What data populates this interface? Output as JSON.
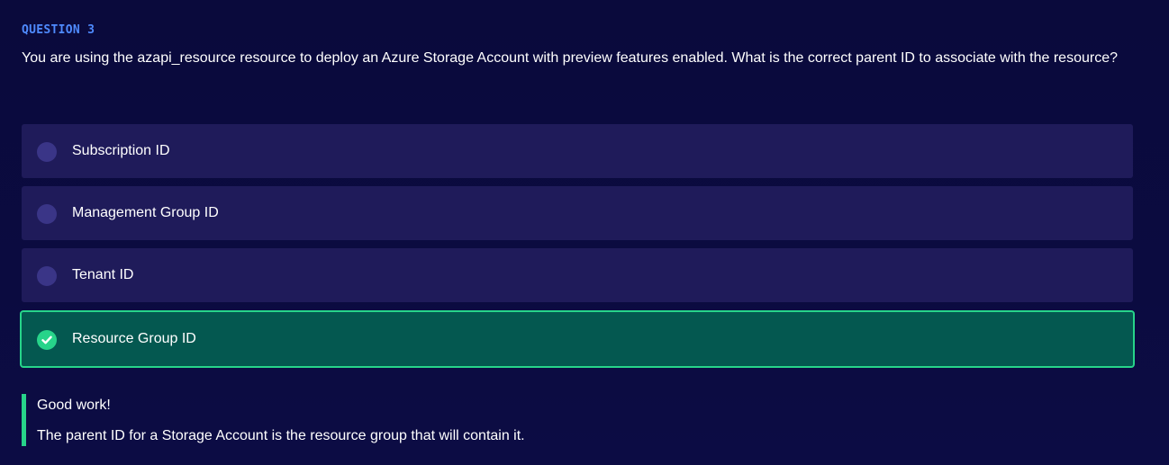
{
  "question": {
    "label": "QUESTION 3",
    "text": "You are using the azapi_resource resource to deploy an Azure Storage Account with preview features enabled. What is the correct parent ID to associate with the resource?"
  },
  "options": [
    {
      "label": "Subscription ID",
      "selected": false
    },
    {
      "label": "Management Group ID",
      "selected": false
    },
    {
      "label": "Tenant ID",
      "selected": false
    },
    {
      "label": "Resource Group ID",
      "selected": true
    }
  ],
  "feedback": {
    "title": "Good work!",
    "body": "The parent ID for a Storage Account is the resource group that will contain it."
  },
  "colors": {
    "background": "#0a0a3c",
    "option_bg": "#1f1b5a",
    "radio_bg": "#3a3587",
    "selected_bg": "#045850",
    "accent_green": "#27d48a",
    "question_label": "#4f8bff"
  },
  "icons": {
    "selected_check": "check-circle-icon"
  }
}
